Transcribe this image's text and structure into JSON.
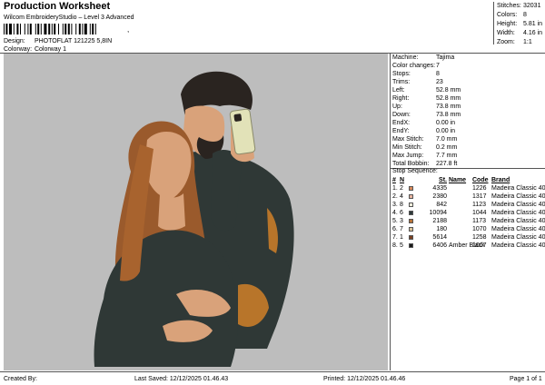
{
  "header": {
    "title": "Production Worksheet",
    "subtitle": "Wilcom EmbroideryStudio – Level 3 Advanced",
    "barcode_trail": ",",
    "design_label": "Design:",
    "design_value": "PHOTOFLAT 121225 5,8IN",
    "colorway_label": "Colorway:",
    "colorway_value": "Colorway 1"
  },
  "stats": [
    {
      "label": "Stitches:",
      "value": "32031"
    },
    {
      "label": "Colors:",
      "value": "8"
    },
    {
      "label": "Height:",
      "value": "5.81 in"
    },
    {
      "label": "Width:",
      "value": "4.16 in"
    },
    {
      "label": "Zoom:",
      "value": "1:1"
    }
  ],
  "machine": [
    {
      "label": "Machine:",
      "value": "Tajima"
    },
    {
      "label": "Color changes:",
      "value": "7"
    },
    {
      "label": "Stops:",
      "value": "8"
    },
    {
      "label": "Trims:",
      "value": "23"
    },
    {
      "label": "Left:",
      "value": "52.8 mm"
    },
    {
      "label": "Right:",
      "value": "52.8 mm"
    },
    {
      "label": "Up:",
      "value": "73.8 mm"
    },
    {
      "label": "Down:",
      "value": "73.8 mm"
    },
    {
      "label": "EndX:",
      "value": "0.00 in"
    },
    {
      "label": "EndY:",
      "value": "0.00 in"
    },
    {
      "label": "Max Stitch:",
      "value": "7.0 mm"
    },
    {
      "label": "Min Stitch:",
      "value": "0.2 mm"
    },
    {
      "label": "Max Jump:",
      "value": "7.7 mm"
    },
    {
      "label": "Total Bobbin:",
      "value": "227.8 ft"
    }
  ],
  "stop_sequence": {
    "title": "Stop Sequence:",
    "headers": {
      "num": "#",
      "n": "N",
      "st": "St.",
      "name": "Name",
      "code": "Code",
      "brand": "Brand"
    },
    "rows": [
      {
        "num": "1.",
        "n": "2",
        "color": "#d88a5c",
        "st": "4335",
        "name": "",
        "code": "1226",
        "brand": "Madeira Classic 40"
      },
      {
        "num": "2.",
        "n": "4",
        "color": "#e8b4a0",
        "st": "2380",
        "name": "",
        "code": "1317",
        "brand": "Madeira Classic 40"
      },
      {
        "num": "3.",
        "n": "8",
        "color": "#f2eedc",
        "st": "842",
        "name": "",
        "code": "1123",
        "brand": "Madeira Classic 40"
      },
      {
        "num": "4.",
        "n": "6",
        "color": "#2e3a3a",
        "st": "10094",
        "name": "",
        "code": "1044",
        "brand": "Madeira Classic 40"
      },
      {
        "num": "5.",
        "n": "3",
        "color": "#b87338",
        "st": "2188",
        "name": "",
        "code": "1173",
        "brand": "Madeira Classic 40"
      },
      {
        "num": "6.",
        "n": "7",
        "color": "#dcc49a",
        "st": "180",
        "name": "",
        "code": "1070",
        "brand": "Madeira Classic 40"
      },
      {
        "num": "7.",
        "n": "1",
        "color": "#7a4020",
        "st": "5614",
        "name": "",
        "code": "1258",
        "brand": "Madeira Classic 40"
      },
      {
        "num": "8.",
        "n": "5",
        "color": "#1a1a1a",
        "st": "6406",
        "name": "Amber Black",
        "code": "1007",
        "brand": "Madeira Classic 40"
      }
    ]
  },
  "footer": {
    "created": "Created By:",
    "saved": "Last Saved: 12/12/2025 01.46.43",
    "printed": "Printed: 12/12/2025 01.46.46",
    "page": "Page 1 of 1"
  },
  "colors": {
    "canvas_bg": "#bdbdbd",
    "skin": "#d9a27a",
    "hair_woman": "#9a5a2c",
    "hair_man": "#2a2420",
    "sweater": "#2f3836",
    "phone": "#e2e2b8",
    "gold_accent": "#b8752a"
  }
}
